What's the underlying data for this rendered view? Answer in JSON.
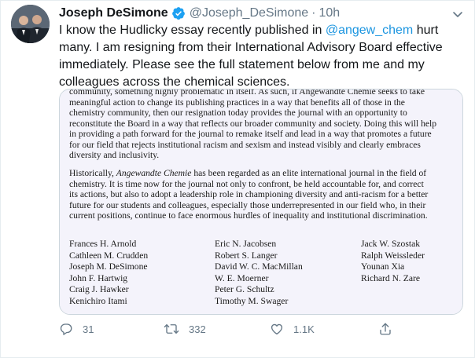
{
  "tweet": {
    "author_name": "Joseph DeSimone",
    "handle": "@Joseph_DeSimone",
    "separator": "·",
    "time": "10h",
    "text_before_mention": "I know the Hudlicky essay recently published in ",
    "mention": "@angew_chem",
    "text_after_mention": " hurt many.  I am resigning from their International Advisory Board effective immediately.  Please see the full statement below from me and my colleagues across the chemical sciences."
  },
  "statement": {
    "para1_lines": [
      "community, something highly problematic in itself. As such, if Angewandte Chemie seeks to take",
      "meaningful action to change its publishing practices in a way that benefits all of those in the",
      "chemistry community, then our resignation today provides the journal with an opportunity to",
      "reconstitute the Board in a way that reflects our broader community and society. Doing this will help",
      "in providing a path forward for the journal to remake itself and lead in a way that promotes a future",
      "for our field that rejects institutional racism and sexism and instead visibly and clearly embraces",
      "diversity and inclusivity."
    ],
    "para2_lead": "Historically, ",
    "para2_journal": "Angewandte Chemie",
    "para2_rest_first": " has been regarded as an elite international journal in the field of",
    "para2_lines": [
      "chemistry. It is time now for the journal not only to confront, be held accountable for, and correct",
      "its actions, but also to adopt a leadership role in championing diversity and anti-racism for a better",
      "future for our students and colleagues, especially those underrepresented in our field who, in their",
      "current positions, continue to face enormous hurdles of inequality and institutional discrimination."
    ],
    "signatories": [
      [
        "Frances H. Arnold",
        "Cathleen M. Crudden",
        "Joseph M. DeSimone",
        "John F. Hartwig",
        "Craig J. Hawker",
        "Kenichiro Itami"
      ],
      [
        "Eric N. Jacobsen",
        "Robert S. Langer",
        "David W. C. MacMillan",
        "W. E. Moerner",
        "Peter G. Schultz",
        "Timothy M. Swager"
      ],
      [
        "Jack W. Szostak",
        "Ralph Weissleder",
        "Younan Xia",
        "Richard N. Zare"
      ]
    ]
  },
  "actions": {
    "reply_count": "31",
    "retweet_count": "332",
    "like_count": "1.1K"
  },
  "icons": {
    "verified": "verified-badge-icon",
    "caret": "chevron-down-icon",
    "reply": "reply-icon",
    "retweet": "retweet-icon",
    "like": "heart-icon",
    "share": "share-icon"
  },
  "colors": {
    "link": "#1b95e0",
    "muted": "#657786",
    "text": "#14171a",
    "document_bg": "#f4f3fb"
  }
}
